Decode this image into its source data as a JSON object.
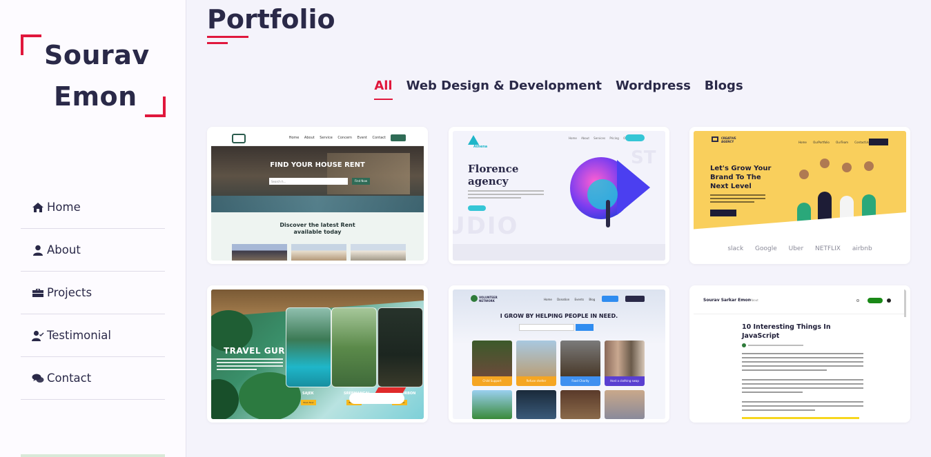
{
  "sidebar": {
    "logo_line1": "Sourav",
    "logo_line2": "Emon",
    "nav": [
      {
        "label": "Home",
        "icon": "home-icon"
      },
      {
        "label": "About",
        "icon": "user-icon"
      },
      {
        "label": "Projects",
        "icon": "briefcase-icon"
      },
      {
        "label": "Testimonial",
        "icon": "user-check-icon"
      },
      {
        "label": "Contact",
        "icon": "comments-icon"
      }
    ]
  },
  "main": {
    "title": "Portfolio",
    "tabs": [
      {
        "label": "All",
        "active": true
      },
      {
        "label": "Web Design & Development",
        "active": false
      },
      {
        "label": "Wordpress",
        "active": false
      },
      {
        "label": "Blogs",
        "active": false
      }
    ]
  },
  "projects": {
    "house": {
      "hero_title": "FIND YOUR HOUSE RENT",
      "search_placeholder": "Search h...",
      "search_button": "Find Now",
      "body_title_1": "Discover the latest Rent",
      "body_title_2": "available today"
    },
    "athena": {
      "logo_text": "Athena",
      "title_1": "Florence",
      "title_2": "agency",
      "big_text": "UDIO",
      "big_text_2": "ST"
    },
    "creative": {
      "logo_text_1": "CREATIVE",
      "logo_text_2": "AGENCY",
      "title_1": "Let's Grow Your",
      "title_2": "Brand To The",
      "title_3": "Next Level",
      "brands": "slack Google Uber NETFLIX airbnb"
    },
    "travel": {
      "title": "TRAVEL GURU",
      "label_1": "SAJEK",
      "label_2": "SREEMANGAL",
      "label_3": "SUNDORBON",
      "book_label": "Book Now"
    },
    "volunteer": {
      "logo_text_1": "VOLUNTEER",
      "logo_text_2": "NETWORK",
      "title": "I GROW BY HELPING PEOPLE IN NEED.",
      "tiles": [
        "Child Support",
        "Refuse shelter",
        "Food Charity",
        "Host a clothing swap"
      ]
    },
    "blog": {
      "author": "Sourav Sarkar Emon",
      "about": "About",
      "title_1": "10 Interesting Things In",
      "title_2": "JavaScript"
    }
  },
  "colors": {
    "accent": "#e0173c",
    "text_dark": "#2a2948",
    "background": "#f4f3fb"
  }
}
